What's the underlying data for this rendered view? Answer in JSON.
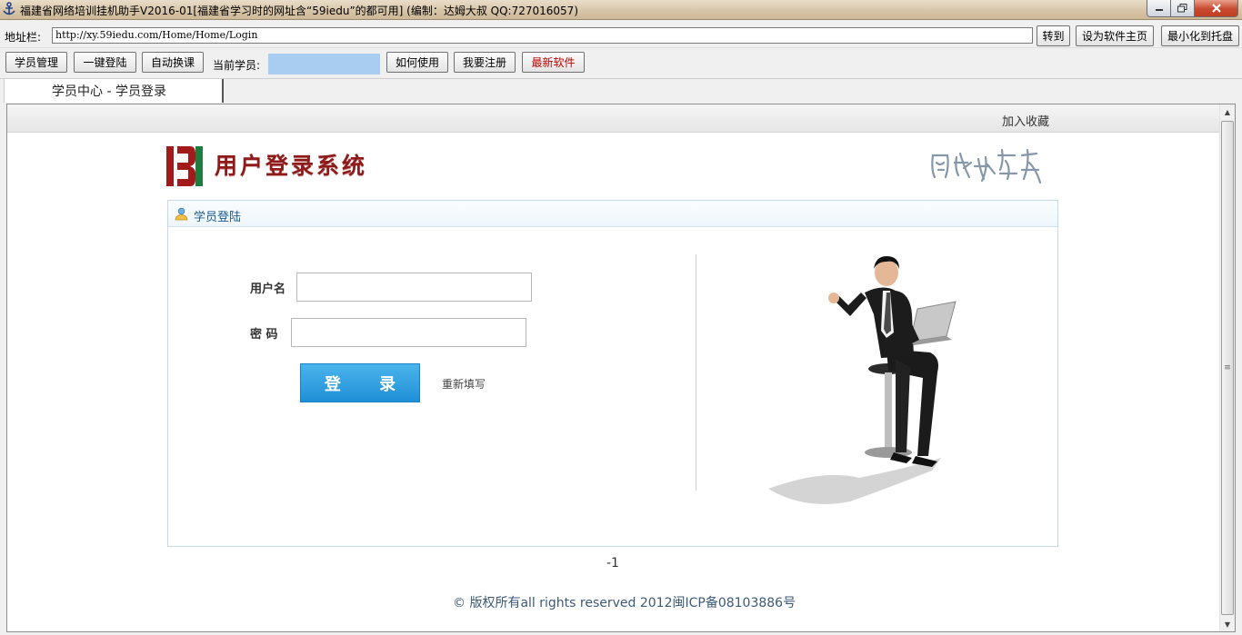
{
  "window": {
    "title": "福建省网络培训挂机助手V2016-01[福建省学习时的网址含“59iedu”的都可用] (编制：达姆大叔 QQ:727016057)"
  },
  "address_bar": {
    "label": "地址栏:",
    "url": "http://xy.59iedu.com/Home/Home/Login",
    "go_label": "转到",
    "set_home_label": "设为软件主页",
    "tray_label": "最小化到托盘"
  },
  "toolbar": {
    "member_manage": "学员管理",
    "one_click_login": "一键登陆",
    "auto_switch": "自动换课",
    "current_member_label": "当前学员:",
    "how_to_use": "如何使用",
    "register": "我要注册",
    "latest_software": "最新软件"
  },
  "tab": {
    "label": "学员中心 - 学员登录"
  },
  "page": {
    "add_favorite": "加入收藏",
    "system_title": "用户登录系统",
    "panel_title": "学员登陆",
    "username_label": "用户名",
    "password_label": "密 码",
    "login_button": "登 录",
    "reset_link": "重新填写",
    "page_number": "-1",
    "copyright": "© 版权所有all rights reserved 2012闽ICP备08103886号"
  },
  "colors": {
    "brand_red": "#8e1a1a",
    "login_blue": "#1f8fd6",
    "member_box": "#a8cdf0",
    "link_red": "#c00000"
  }
}
